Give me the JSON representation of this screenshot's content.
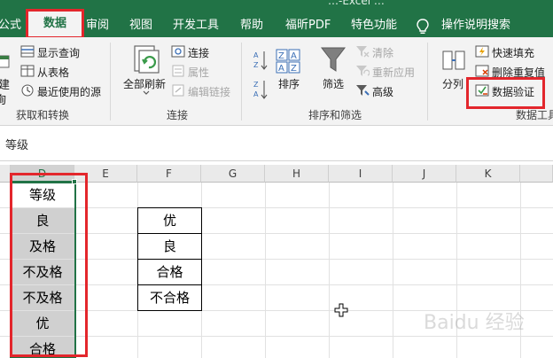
{
  "title_fragment": "…-Excel …",
  "tabs": [
    {
      "label": "公式",
      "active": false
    },
    {
      "label": "数据",
      "active": true
    },
    {
      "label": "审阅",
      "active": false
    },
    {
      "label": "视图",
      "active": false
    },
    {
      "label": "开发工具",
      "active": false
    },
    {
      "label": "帮助",
      "active": false
    },
    {
      "label": "福昕PDF",
      "active": false
    },
    {
      "label": "特色功能",
      "active": false
    }
  ],
  "tell_me": "操作说明搜索",
  "ribbon": {
    "get_transform": {
      "new_query_frag": "建",
      "new_query_frag2": "询",
      "show_queries": "显示查询",
      "from_table": "从表格",
      "recent_sources": "最近使用的源",
      "label": "获取和转换"
    },
    "connections": {
      "refresh_all": "全部刷新",
      "connections": "连接",
      "properties": "属性",
      "edit_links": "编辑链接",
      "label": "连接"
    },
    "sort_filter": {
      "sort": "排序",
      "filter": "筛选",
      "clear": "清除",
      "reapply": "重新应用",
      "advanced": "高级",
      "label": "排序和筛选"
    },
    "data_tools": {
      "split_column": "分列",
      "flash_fill": "快速填充",
      "remove_duplicates": "删除重复值",
      "data_validation": "数据验证",
      "label": "数据工具"
    }
  },
  "formula_bar": {
    "value": "等级"
  },
  "columns": [
    "D",
    "E",
    "F",
    "G",
    "H",
    "I",
    "J",
    "K"
  ],
  "column_d_cells": [
    "等级",
    "良",
    "及格",
    "不及格",
    "不及格",
    "优",
    "合格"
  ],
  "column_f_cells": [
    "优",
    "良",
    "合格",
    "不合格"
  ],
  "watermark": "Baidu 经验",
  "colors": {
    "accent": "#217346",
    "highlight": "#e3262c"
  }
}
